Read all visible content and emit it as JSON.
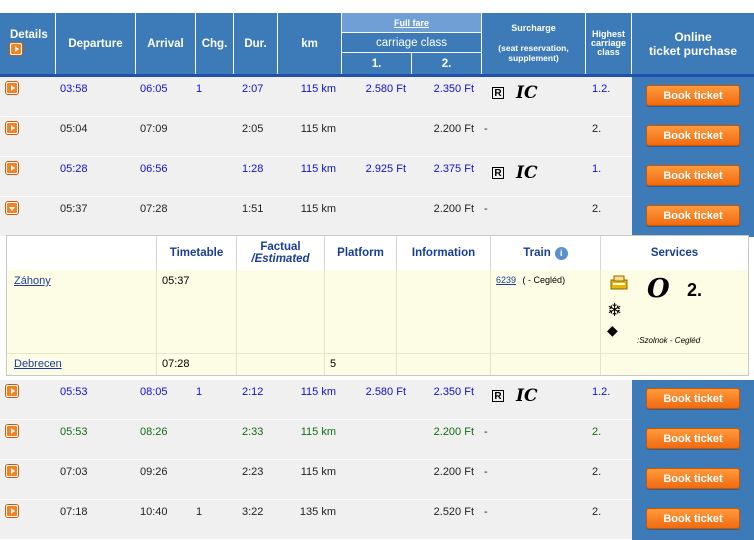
{
  "header": {
    "details": "Details",
    "departure": "Departure",
    "arrival": "Arrival",
    "chg": "Chg.",
    "dur": "Dur.",
    "km": "km",
    "full_fare": "Full fare",
    "carriage_class": "carriage class",
    "class1": "1.",
    "class2": "2.",
    "surcharge": "Surcharge",
    "surcharge_sub": "(seat reservation, supplement)",
    "highest": "Highest carriage class",
    "online_line1": "Online",
    "online_line2": "ticket purchase"
  },
  "book_label": "Book ticket",
  "rows_top": [
    {
      "dep": "03:58",
      "arr": "06:05",
      "chg": "1",
      "dur": "2:07",
      "km": "115 km",
      "p1": "2.580 Ft",
      "p2": "2.350 Ft",
      "dash": "",
      "r": "R",
      "ic": "IC",
      "hc": "1.2.",
      "color": "blue"
    },
    {
      "dep": "05:04",
      "arr": "07:09",
      "chg": "",
      "dur": "2:05",
      "km": "115 km",
      "p1": "",
      "p2": "2.200 Ft",
      "dash": "-",
      "r": "",
      "ic": "",
      "hc": "2.",
      "color": "black"
    },
    {
      "dep": "05:28",
      "arr": "06:56",
      "chg": "",
      "dur": "1:28",
      "km": "115 km",
      "p1": "2.925 Ft",
      "p2": "2.375 Ft",
      "dash": "",
      "r": "R",
      "ic": "IC",
      "hc": "1.",
      "color": "blue"
    },
    {
      "dep": "05:37",
      "arr": "07:28",
      "chg": "",
      "dur": "1:51",
      "km": "115 km",
      "p1": "",
      "p2": "2.200 Ft",
      "dash": "-",
      "r": "",
      "ic": "",
      "hc": "2.",
      "color": "black"
    }
  ],
  "detail": {
    "h_timetable": "Timetable",
    "h_factual": "Factual",
    "h_estimated": "/Estimated",
    "h_platform": "Platform",
    "h_information": "Information",
    "h_train": "Train",
    "info_glyph": "i",
    "h_services": "Services",
    "stop1_name": "Záhony",
    "stop1_time": "05:37",
    "train_number": "6239",
    "train_route": "( - Cegléd)",
    "svc_O": "O",
    "svc_2": "2.",
    "svc_snow": "❄",
    "svc_diamond": "◆",
    "svc_note": ":Szolnok - Cegléd",
    "stop2_name": "Debrecen",
    "stop2_time": "07:28",
    "stop2_platform": "5"
  },
  "rows_bottom": [
    {
      "dep": "05:53",
      "arr": "08:05",
      "chg": "1",
      "dur": "2:12",
      "km": "115 km",
      "p1": "2.580 Ft",
      "p2": "2.350 Ft",
      "dash": "",
      "r": "R",
      "ic": "IC",
      "hc": "1.2.",
      "color": "blue"
    },
    {
      "dep": "05:53",
      "arr": "08:26",
      "chg": "",
      "dur": "2:33",
      "km": "115 km",
      "p1": "",
      "p2": "2.200 Ft",
      "dash": "-",
      "r": "",
      "ic": "",
      "hc": "2.",
      "color": "green"
    },
    {
      "dep": "07:03",
      "arr": "09:26",
      "chg": "",
      "dur": "2:23",
      "km": "115 km",
      "p1": "",
      "p2": "2.200 Ft",
      "dash": "-",
      "r": "",
      "ic": "",
      "hc": "2.",
      "color": "black"
    },
    {
      "dep": "07:18",
      "arr": "10:40",
      "chg": "1",
      "dur": "3:22",
      "km": "135 km",
      "p1": "",
      "p2": "2.520 Ft",
      "dash": "-",
      "r": "",
      "ic": "",
      "hc": "2.",
      "color": "black"
    }
  ]
}
